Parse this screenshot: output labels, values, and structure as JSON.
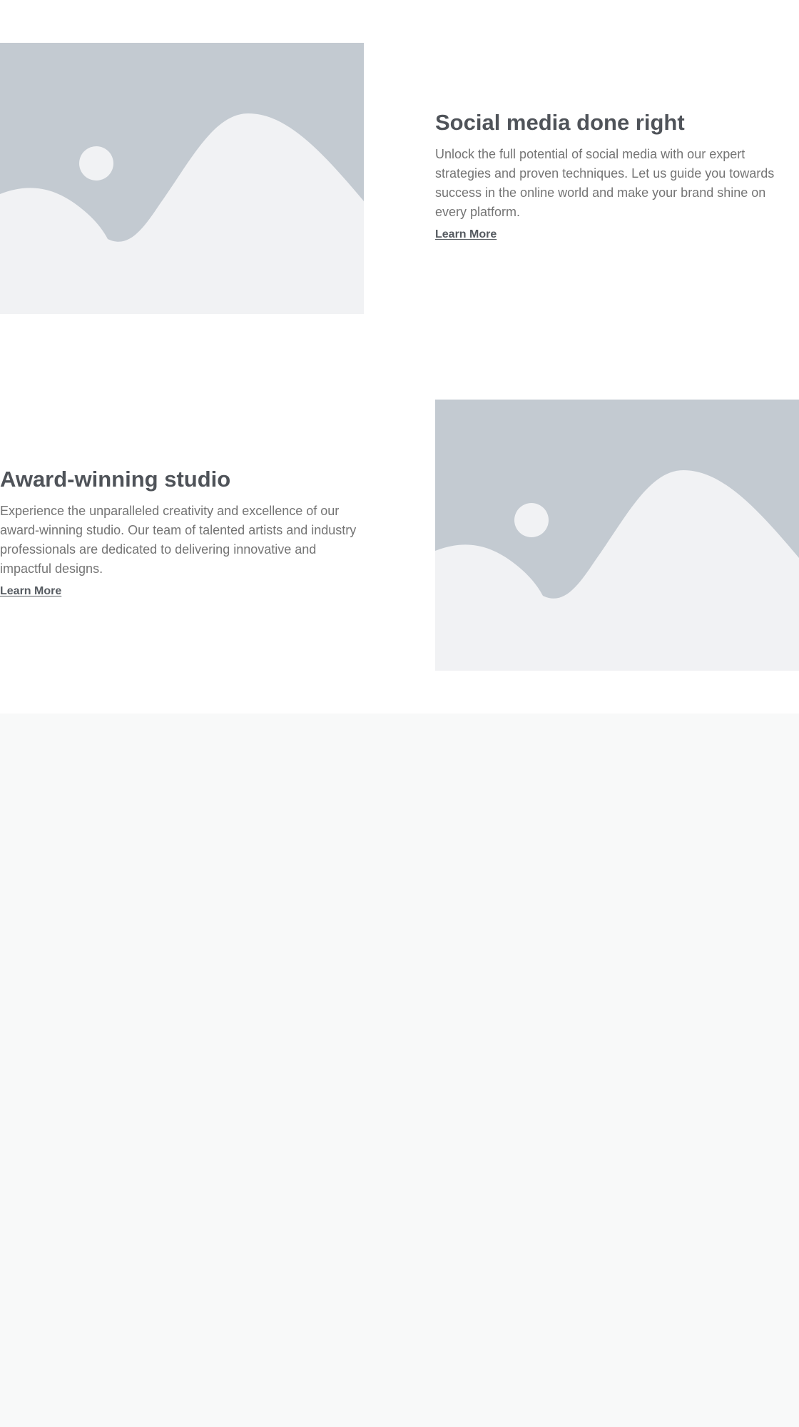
{
  "features": [
    {
      "title": "Social media done right",
      "description": "Unlock the full potential of social media with our expert strategies and proven techniques. Let us guide you towards success in the online world and make your brand shine on every platform.",
      "link_label": "Learn More",
      "image_icon": "image-placeholder-icon"
    },
    {
      "title": "Award-winning studio",
      "description": "Experience the unparalleled creativity and excellence of our award-winning studio. Our team of talented artists and industry professionals are dedicated to delivering innovative and impactful designs.",
      "link_label": "Learn More",
      "image_icon": "image-placeholder-icon"
    }
  ],
  "colors": {
    "heading": "#4f5359",
    "body_text": "#747474",
    "link": "#555a60",
    "image_sky": "#c3cad1",
    "image_ground": "#f1f2f4",
    "lower_background": "#f8f9f9"
  }
}
